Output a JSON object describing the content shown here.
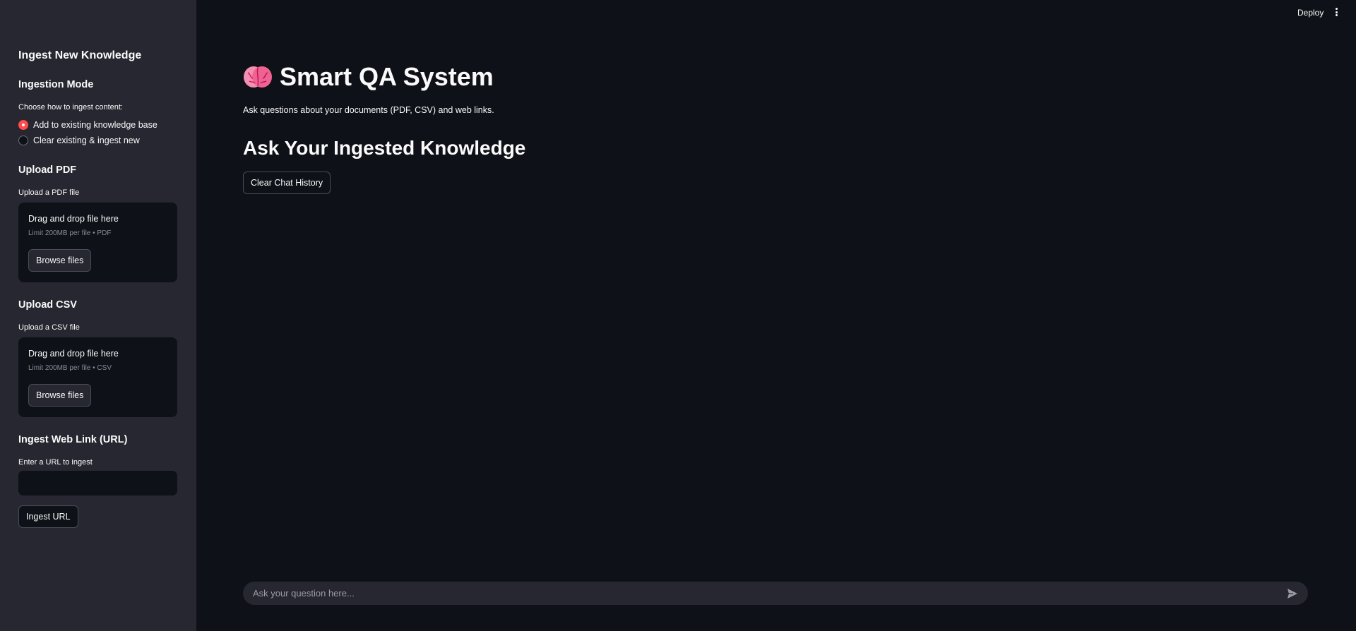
{
  "topbar": {
    "deploy_label": "Deploy",
    "menu_icon": "kebab-menu-icon"
  },
  "sidebar": {
    "title": "Ingest New Knowledge",
    "ingestion_mode": {
      "heading": "Ingestion Mode",
      "label": "Choose how to ingest content:",
      "options": [
        {
          "label": "Add to existing knowledge base",
          "selected": true
        },
        {
          "label": "Clear existing & ingest new",
          "selected": false
        }
      ]
    },
    "upload_pdf": {
      "heading": "Upload PDF",
      "label": "Upload a PDF file",
      "drop_title": "Drag and drop file here",
      "drop_limit": "Limit 200MB per file • PDF",
      "browse_label": "Browse files"
    },
    "upload_csv": {
      "heading": "Upload CSV",
      "label": "Upload a CSV file",
      "drop_title": "Drag and drop file here",
      "drop_limit": "Limit 200MB per file • CSV",
      "browse_label": "Browse files"
    },
    "web_link": {
      "heading": "Ingest Web Link (URL)",
      "label": "Enter a URL to ingest",
      "value": "",
      "button_label": "Ingest URL"
    }
  },
  "main": {
    "title_icon": "brain-icon",
    "title": "Smart QA System",
    "subtitle": "Ask questions about your documents (PDF, CSV) and web links.",
    "section_heading": "Ask Your Ingested Knowledge",
    "clear_button_label": "Clear Chat History"
  },
  "chat": {
    "placeholder": "Ask your question here...",
    "value": "",
    "send_icon": "send-icon"
  },
  "colors": {
    "background": "#0e1117",
    "sidebar": "#262730",
    "accent": "#ff4b4b",
    "text": "#fafafa"
  }
}
